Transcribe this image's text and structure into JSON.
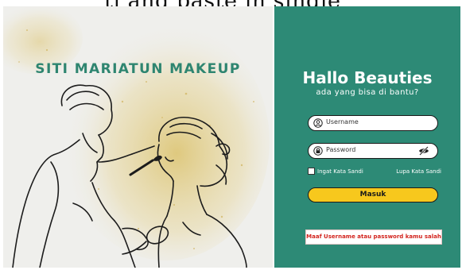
{
  "header": {
    "text": "ti and paste in single"
  },
  "left_panel": {
    "brand_title": "SITI MARIATUN MAKEUP"
  },
  "login": {
    "title": "Hallo Beauties",
    "subtitle": "ada yang bisa di bantu?",
    "username": {
      "placeholder": "Username",
      "icon": "user-circle-icon"
    },
    "password": {
      "placeholder": "Password",
      "icon": "lock-icon",
      "toggle_icon": "eye-slash-icon"
    },
    "remember_label": "Ingat Kata Sandi",
    "forgot_label": "Lupa Kata Sandi",
    "submit_label": "Masuk",
    "error_message": "Maaf Username atau password kamu salah"
  },
  "colors": {
    "brand_green": "#2d8a76",
    "title_green": "#2e8570",
    "button_yellow": "#f7c81d",
    "error_red": "#d3241e",
    "glitter_gold": "#d4b24a"
  }
}
